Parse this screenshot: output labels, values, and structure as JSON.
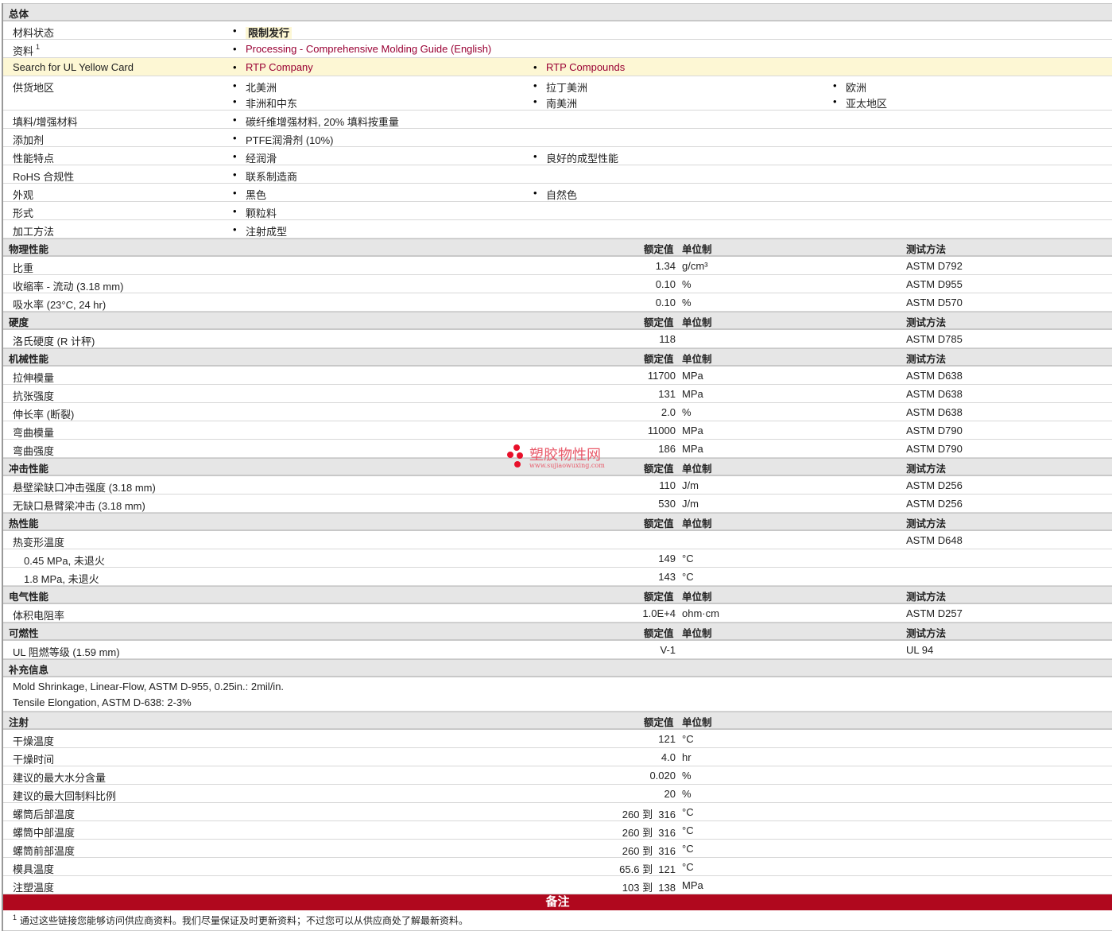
{
  "general": {
    "title": "总体",
    "rows": [
      {
        "label": "材料状态",
        "items": [
          [
            "限制发行"
          ]
        ],
        "type": "tag"
      },
      {
        "label": "资料",
        "sup": "1",
        "items": [
          [
            "Processing - Comprehensive Molding Guide (English)"
          ]
        ],
        "type": "link"
      },
      {
        "label": "Search for UL Yellow Card",
        "items": [
          [
            "RTP Company"
          ],
          [
            "RTP Compounds"
          ]
        ],
        "type": "link",
        "highlight": true
      },
      {
        "label": "供货地区",
        "items": [
          [
            "北美洲",
            "非洲和中东"
          ],
          [
            "拉丁美洲",
            "南美洲"
          ],
          [
            "欧洲",
            "亚太地区"
          ]
        ]
      },
      {
        "label": "填料/增强材料",
        "items": [
          [
            "碳纤维增强材料, 20% 填料按重量"
          ]
        ]
      },
      {
        "label": "添加剂",
        "items": [
          [
            "PTFE润滑剂 (10%)"
          ]
        ]
      },
      {
        "label": "性能特点",
        "items": [
          [
            "经润滑"
          ],
          [
            "良好的成型性能"
          ]
        ]
      },
      {
        "label": "RoHS 合规性",
        "items": [
          [
            "联系制造商"
          ]
        ]
      },
      {
        "label": "外观",
        "items": [
          [
            "黑色"
          ],
          [
            "自然色"
          ]
        ]
      },
      {
        "label": "形式",
        "items": [
          [
            "颗粒料"
          ]
        ]
      },
      {
        "label": "加工方法",
        "items": [
          [
            "注射成型"
          ]
        ]
      }
    ]
  },
  "headers": {
    "value": "额定值",
    "unit": "单位制",
    "method": "测试方法"
  },
  "sections": [
    {
      "title": "物理性能",
      "method": true,
      "rows": [
        {
          "label": "比重",
          "value": "1.34",
          "unit": "g/cm³",
          "method": "ASTM D792"
        },
        {
          "label": "收缩率 - 流动 (3.18 mm)",
          "value": "0.10",
          "unit": "%",
          "method": "ASTM D955"
        },
        {
          "label": "吸水率 (23°C, 24 hr)",
          "value": "0.10",
          "unit": "%",
          "method": "ASTM D570"
        }
      ]
    },
    {
      "title": "硬度",
      "method": true,
      "rows": [
        {
          "label": "洛氏硬度 (R 计秤)",
          "value": "118",
          "unit": "",
          "method": "ASTM D785"
        }
      ]
    },
    {
      "title": "机械性能",
      "method": true,
      "rows": [
        {
          "label": "拉伸模量",
          "value": "11700",
          "unit": "MPa",
          "method": "ASTM D638"
        },
        {
          "label": "抗张强度",
          "value": "131",
          "unit": "MPa",
          "method": "ASTM D638"
        },
        {
          "label": "伸长率 (断裂)",
          "value": "2.0",
          "unit": "%",
          "method": "ASTM D638"
        },
        {
          "label": "弯曲模量",
          "value": "11000",
          "unit": "MPa",
          "method": "ASTM D790"
        },
        {
          "label": "弯曲强度",
          "value": "186",
          "unit": "MPa",
          "method": "ASTM D790"
        }
      ]
    },
    {
      "title": "冲击性能",
      "method": true,
      "rows": [
        {
          "label": "悬壁梁缺口冲击强度 (3.18 mm)",
          "value": "110",
          "unit": "J/m",
          "method": "ASTM D256"
        },
        {
          "label": "无缺口悬臂梁冲击 (3.18 mm)",
          "value": "530",
          "unit": "J/m",
          "method": "ASTM D256"
        }
      ]
    },
    {
      "title": "热性能",
      "method": true,
      "rows": [
        {
          "label": "热变形温度",
          "value": "",
          "unit": "",
          "method": "ASTM D648"
        },
        {
          "label": "0.45 MPa, 未退火",
          "value": "149",
          "unit": "°C",
          "method": "",
          "indent": true
        },
        {
          "label": "1.8 MPa, 未退火",
          "value": "143",
          "unit": "°C",
          "method": "",
          "indent": true
        }
      ]
    },
    {
      "title": "电气性能",
      "method": true,
      "rows": [
        {
          "label": "体积电阻率",
          "value": "1.0E+4",
          "unit": "ohm·cm",
          "method": "ASTM D257"
        }
      ]
    },
    {
      "title": "可燃性",
      "method": true,
      "rows": [
        {
          "label": "UL 阻燃等级 (1.59 mm)",
          "value": "V-1",
          "unit": "",
          "method": "UL 94"
        }
      ]
    }
  ],
  "supplement": {
    "title": "补充信息",
    "lines": [
      "Mold Shrinkage, Linear-Flow, ASTM D-955, 0.25in.: 2mil/in.",
      "Tensile Elongation, ASTM D-638: 2-3%"
    ]
  },
  "injection": {
    "title": "注射",
    "rows": [
      {
        "label": "干燥温度",
        "value": "121",
        "unit": "°C"
      },
      {
        "label": "干燥时间",
        "value": "4.0",
        "unit": "hr"
      },
      {
        "label": "建议的最大水分含量",
        "value": "0.020",
        "unit": "%"
      },
      {
        "label": "建议的最大回制料比例",
        "value": "20",
        "unit": "%"
      },
      {
        "label": "螺筒后部温度",
        "value": "260 到  316",
        "unit": "°C"
      },
      {
        "label": "螺筒中部温度",
        "value": "260 到  316",
        "unit": "°C"
      },
      {
        "label": "螺筒前部温度",
        "value": "260 到  316",
        "unit": "°C"
      },
      {
        "label": "模具温度",
        "value": "65.6 到  121",
        "unit": "°C"
      },
      {
        "label": "注塑温度",
        "value": "103 到  138",
        "unit": "MPa"
      }
    ]
  },
  "notes": {
    "title": "备注",
    "footnote_mark": "1",
    "footnote": "通过这些链接您能够访问供应商资料。我们尽量保证及时更新资料；不过您可以从供应商处了解最新资料。"
  },
  "watermark": {
    "name": "塑胶物性网",
    "url": "www.sujiaowuxing.com"
  },
  "colors": {
    "link": "#990033",
    "notes_bar": "#b0081e",
    "highlight": "#fdf7d4"
  }
}
